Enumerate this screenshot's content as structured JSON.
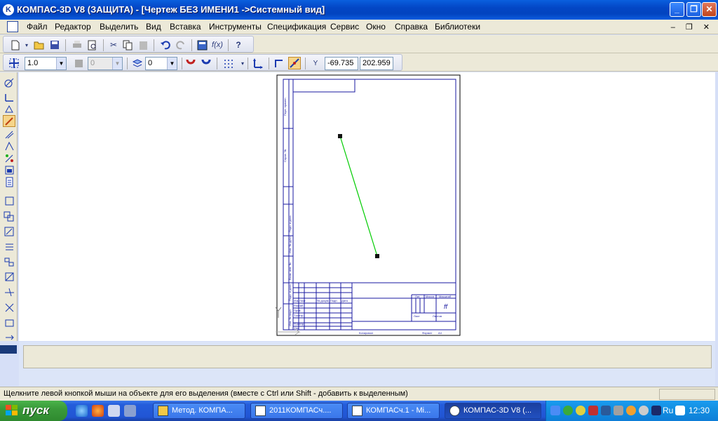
{
  "window": {
    "title": "КОМПАС-3D V8 (ЗАЩИТА) - [Чертеж БЕЗ ИМЕНИ1 ->Системный вид]",
    "app_icon_letter": "K",
    "minimize_glyph": "_",
    "maximize_glyph": "❐",
    "close_glyph": "✕"
  },
  "menu": {
    "items": [
      {
        "label": "Файл"
      },
      {
        "label": "Редактор"
      },
      {
        "label": "Выделить"
      },
      {
        "label": "Вид"
      },
      {
        "label": "Вставка"
      },
      {
        "label": "Инструменты"
      },
      {
        "label": "Спецификация"
      },
      {
        "label": "Сервис"
      },
      {
        "label": "Окно"
      },
      {
        "label": "Справка"
      },
      {
        "label": "Библиотеки"
      }
    ],
    "mdi_controls": "‒ ❐ ✕"
  },
  "toolbar_standard": {
    "buttons": [
      "new-document-icon",
      "open-icon",
      "save-icon",
      "print-icon",
      "print-preview-icon",
      "cut-icon",
      "copy-icon",
      "paste-icon",
      "undo-icon",
      "redo-icon",
      "manager-icon",
      "variables-icon",
      "help-cursor-icon"
    ]
  },
  "toolbar_current_state": {
    "scale_value": "1.0",
    "layer_value": "0",
    "style_value": "0",
    "x_label": "Y",
    "x_value": "-69.735",
    "y_value": "202.959"
  },
  "drawing": {
    "line_color": "#00cc00",
    "frame_color": "#1a1aa0",
    "title_block_number": "ff",
    "copied_label": "Копировал",
    "format_label": "Формат",
    "format_value": "A4",
    "tb_labels": {
      "izm": "Изм",
      "list": "Лист",
      "ndokum": "№ докум.",
      "podp": "Подп.",
      "data": "Дата",
      "razrab": "Разраб.",
      "prov": "Пров.",
      "tkontr": "Т.контр.",
      "nkontr": "Н.контр.",
      "utv": "Утв.",
      "lit": "Лит.",
      "massa": "Масса",
      "masshtab": "Масштаб",
      "list2": "Лист",
      "listov": "Листов"
    },
    "side_labels": [
      "Перв. примен.",
      "Справ. №",
      "Подп. и дата",
      "Инв. № дубл.",
      "Взам. инв. №",
      "Подп. и дата",
      "Инв. № подл."
    ]
  },
  "status": {
    "text": "Щелкните левой кнопкой мыши на объекте для его выделения (вместе с Ctrl или Shift - добавить к выделенным)"
  },
  "taskbar": {
    "start_label": "пуск",
    "tasks": [
      {
        "label": "Метод. КОМПА..."
      },
      {
        "label": "2011КОМПАСч...."
      },
      {
        "label": "КОМПАСч.1 - Mi..."
      },
      {
        "label": "КОМПАС-3D V8 (..."
      }
    ],
    "language": "Ru",
    "clock": "12:30"
  }
}
